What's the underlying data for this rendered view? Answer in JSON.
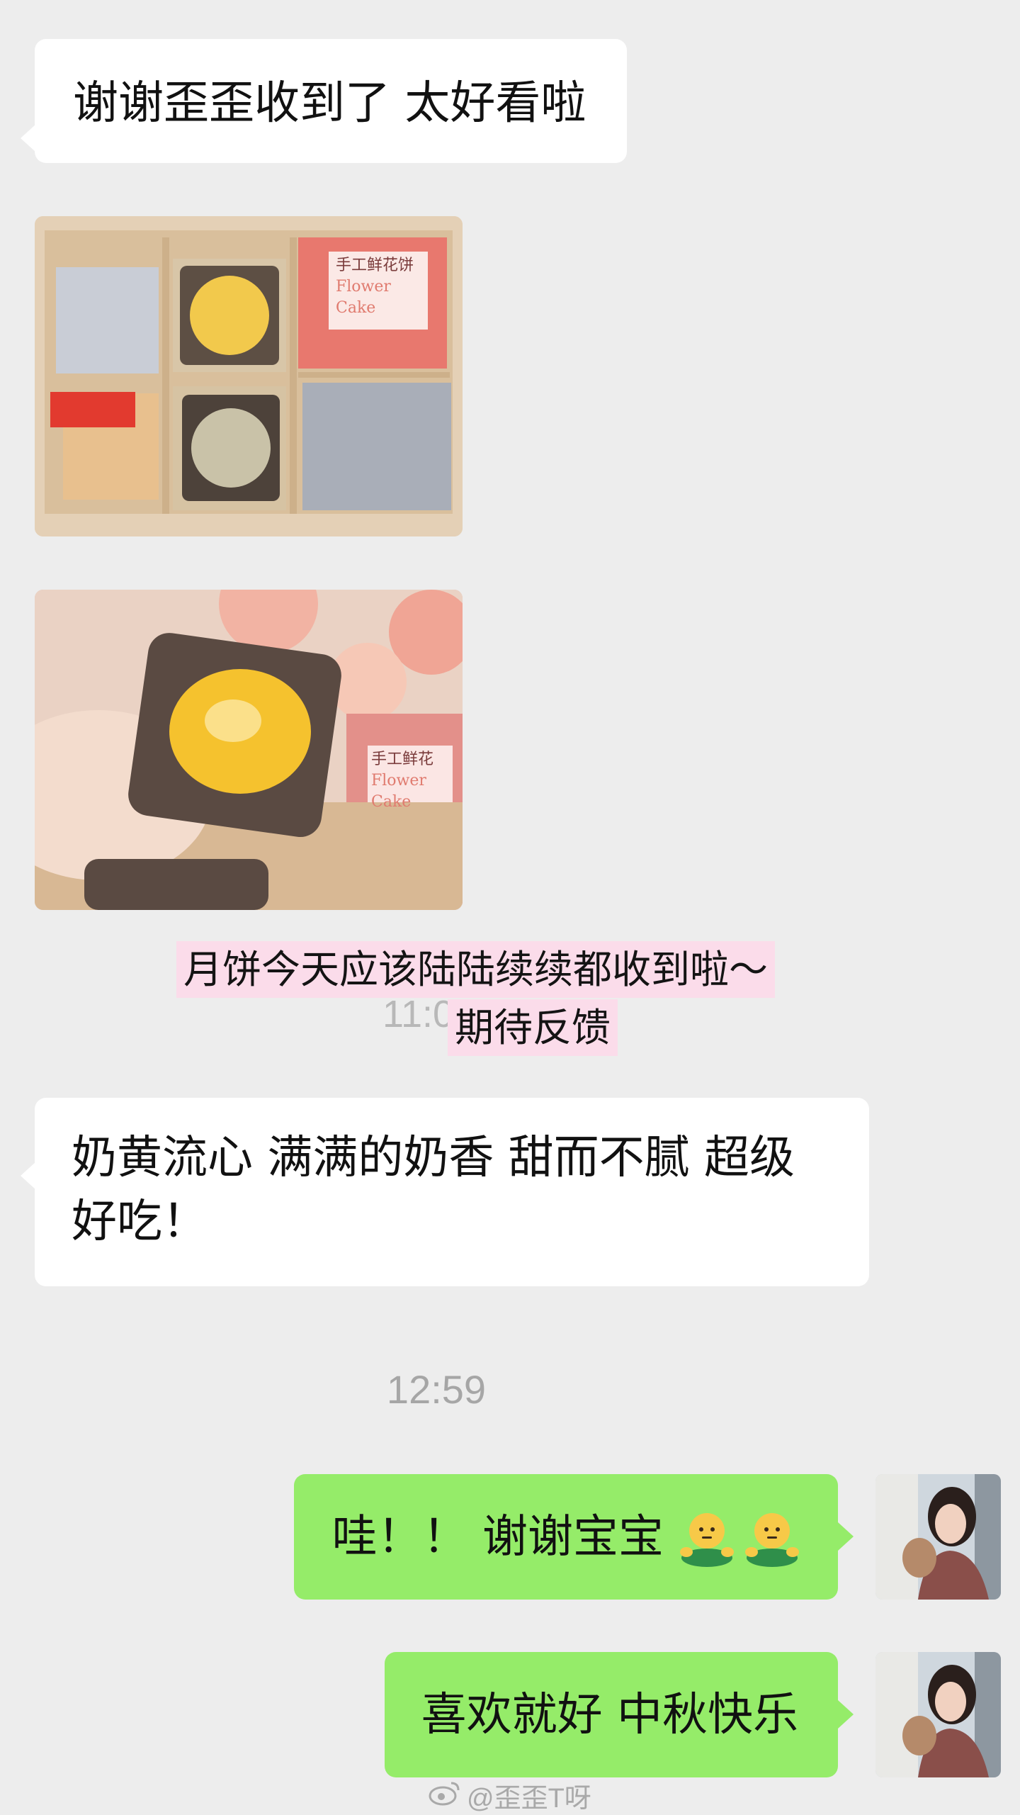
{
  "messages": {
    "received_1": "谢谢歪歪收到了 太好看啦",
    "received_2": "奶黄流心 满满的奶香 甜而不腻 超级好吃！",
    "sent_1": "哇！！ 谢谢宝宝",
    "sent_2": "喜欢就好 中秋快乐"
  },
  "overlay_caption": {
    "line_1": "月饼今天应该陆陆续续都收到啦～",
    "line_2": "期待反馈"
  },
  "ghost_time": "11:0",
  "time_divider": "12:59",
  "photo_1": {
    "card_lines": [
      "手工鲜花饼",
      "Flower",
      "Cake"
    ]
  },
  "photo_2": {
    "card_lines": [
      "手工鲜花",
      "Flower",
      "Cake"
    ]
  },
  "watermark": "@歪歪T呀",
  "icons": {
    "sent_1_emoji": "green-figure-emoji",
    "watermark": "weibo-logo-icon"
  },
  "colors": {
    "background": "#ededed",
    "received_bubble": "#ffffff",
    "sent_bubble": "#95ec69",
    "overlay_highlight": "#fbdcea"
  }
}
